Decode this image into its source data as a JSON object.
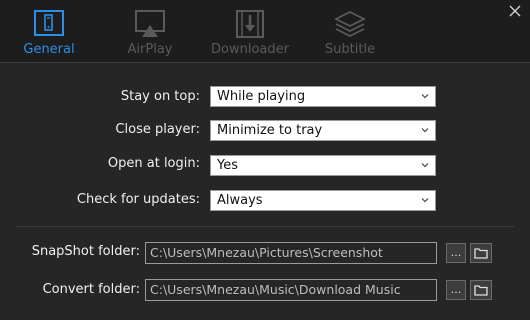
{
  "tabs": [
    {
      "label": "General",
      "icon": "phone-device-icon",
      "active": true
    },
    {
      "label": "AirPlay",
      "icon": "airplay-icon",
      "active": false
    },
    {
      "label": "Downloader",
      "icon": "film-download-icon",
      "active": false
    },
    {
      "label": "Subtitle",
      "icon": "layers-icon",
      "active": false
    }
  ],
  "settings": {
    "stay_on_top": {
      "label": "Stay on top:",
      "value": "While playing"
    },
    "close_player": {
      "label": "Close player:",
      "value": "Minimize to tray"
    },
    "open_at_login": {
      "label": "Open at login:",
      "value": "Yes"
    },
    "check_updates": {
      "label": "Check for updates:",
      "value": "Always"
    }
  },
  "folders": {
    "snapshot": {
      "label": "SnapShot folder:",
      "path": "C:\\Users\\Mnezau\\Pictures\\Screenshot",
      "browse_label": "..."
    },
    "convert": {
      "label": "Convert folder:",
      "path": "C:\\Users\\Mnezau\\Music\\Download Music",
      "browse_label": "..."
    }
  },
  "colors": {
    "accent": "#2b8fe6",
    "inactive": "#5a5a5a",
    "background": "#262626",
    "tabbar": "#1d1d1d"
  }
}
